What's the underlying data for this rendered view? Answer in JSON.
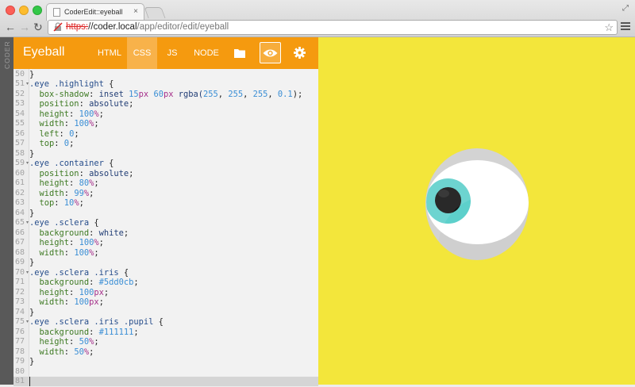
{
  "browser": {
    "tab_title": "CoderEdit::eyeball",
    "url_scheme": "https:",
    "url_host": "//coder.local",
    "url_path": "/app/editor/edit/eyeball",
    "close_glyph": "×"
  },
  "editor": {
    "strip_label": "CODER",
    "app_title": "Eyeball",
    "tabs": [
      {
        "label": "HTML",
        "active": false
      },
      {
        "label": "CSS",
        "active": true
      },
      {
        "label": "JS",
        "active": false
      },
      {
        "label": "NODE",
        "active": false
      }
    ],
    "toolbar_icons": [
      "folder-icon",
      "eye-icon",
      "gear-icon"
    ],
    "toolbar_color": "#f59a0f",
    "line_numbers": [
      "50",
      "51",
      "52",
      "53",
      "54",
      "55",
      "56",
      "57",
      "58",
      "59",
      "60",
      "61",
      "62",
      "63",
      "64",
      "65",
      "66",
      "67",
      "68",
      "69",
      "70",
      "71",
      "72",
      "73",
      "74",
      "75",
      "76",
      "77",
      "78",
      "79",
      "80",
      "81"
    ],
    "fold_lines": [
      "51",
      "59",
      "65",
      "70",
      "75"
    ],
    "code_lines": [
      [
        [
          "}",
          "punc"
        ]
      ],
      [
        [
          ".eye .highlight",
          "sel"
        ],
        [
          " {",
          "punc"
        ]
      ],
      [
        [
          "  box-shadow",
          "prop"
        ],
        [
          ": ",
          "punc"
        ],
        [
          "inset ",
          "val"
        ],
        [
          "15",
          "num"
        ],
        [
          "px",
          "unit"
        ],
        [
          " ",
          "punc"
        ],
        [
          "60",
          "num"
        ],
        [
          "px",
          "unit"
        ],
        [
          " rgba(",
          "val"
        ],
        [
          "255",
          "num"
        ],
        [
          ", ",
          "punc"
        ],
        [
          "255",
          "num"
        ],
        [
          ", ",
          "punc"
        ],
        [
          "255",
          "num"
        ],
        [
          ", ",
          "punc"
        ],
        [
          "0.1",
          "num"
        ],
        [
          ");",
          "punc"
        ]
      ],
      [
        [
          "  position",
          "prop"
        ],
        [
          ": ",
          "punc"
        ],
        [
          "absolute",
          "val"
        ],
        [
          ";",
          "punc"
        ]
      ],
      [
        [
          "  height",
          "prop"
        ],
        [
          ": ",
          "punc"
        ],
        [
          "100",
          "num"
        ],
        [
          "%",
          "unit"
        ],
        [
          ";",
          "punc"
        ]
      ],
      [
        [
          "  width",
          "prop"
        ],
        [
          ": ",
          "punc"
        ],
        [
          "100",
          "num"
        ],
        [
          "%",
          "unit"
        ],
        [
          ";",
          "punc"
        ]
      ],
      [
        [
          "  left",
          "prop"
        ],
        [
          ": ",
          "punc"
        ],
        [
          "0",
          "num"
        ],
        [
          ";",
          "punc"
        ]
      ],
      [
        [
          "  top",
          "prop"
        ],
        [
          ": ",
          "punc"
        ],
        [
          "0",
          "num"
        ],
        [
          ";",
          "punc"
        ]
      ],
      [
        [
          "}",
          "punc"
        ]
      ],
      [
        [
          ".eye .container",
          "sel"
        ],
        [
          " {",
          "punc"
        ]
      ],
      [
        [
          "  position",
          "prop"
        ],
        [
          ": ",
          "punc"
        ],
        [
          "absolute",
          "val"
        ],
        [
          ";",
          "punc"
        ]
      ],
      [
        [
          "  height",
          "prop"
        ],
        [
          ": ",
          "punc"
        ],
        [
          "80",
          "num"
        ],
        [
          "%",
          "unit"
        ],
        [
          ";",
          "punc"
        ]
      ],
      [
        [
          "  width",
          "prop"
        ],
        [
          ": ",
          "punc"
        ],
        [
          "99",
          "num"
        ],
        [
          "%",
          "unit"
        ],
        [
          ";",
          "punc"
        ]
      ],
      [
        [
          "  top",
          "prop"
        ],
        [
          ": ",
          "punc"
        ],
        [
          "10",
          "num"
        ],
        [
          "%",
          "unit"
        ],
        [
          ";",
          "punc"
        ]
      ],
      [
        [
          "}",
          "punc"
        ]
      ],
      [
        [
          ".eye .sclera",
          "sel"
        ],
        [
          " {",
          "punc"
        ]
      ],
      [
        [
          "  background",
          "prop"
        ],
        [
          ": ",
          "punc"
        ],
        [
          "white",
          "val"
        ],
        [
          ";",
          "punc"
        ]
      ],
      [
        [
          "  height",
          "prop"
        ],
        [
          ": ",
          "punc"
        ],
        [
          "100",
          "num"
        ],
        [
          "%",
          "unit"
        ],
        [
          ";",
          "punc"
        ]
      ],
      [
        [
          "  width",
          "prop"
        ],
        [
          ": ",
          "punc"
        ],
        [
          "100",
          "num"
        ],
        [
          "%",
          "unit"
        ],
        [
          ";",
          "punc"
        ]
      ],
      [
        [
          "}",
          "punc"
        ]
      ],
      [
        [
          ".eye .sclera .iris",
          "sel"
        ],
        [
          " {",
          "punc"
        ]
      ],
      [
        [
          "  background",
          "prop"
        ],
        [
          ": ",
          "punc"
        ],
        [
          "#5dd0cb",
          "num"
        ],
        [
          ";",
          "punc"
        ]
      ],
      [
        [
          "  height",
          "prop"
        ],
        [
          ": ",
          "punc"
        ],
        [
          "100",
          "num"
        ],
        [
          "px",
          "unit"
        ],
        [
          ";",
          "punc"
        ]
      ],
      [
        [
          "  width",
          "prop"
        ],
        [
          ": ",
          "punc"
        ],
        [
          "100",
          "num"
        ],
        [
          "px",
          "unit"
        ],
        [
          ";",
          "punc"
        ]
      ],
      [
        [
          "}",
          "punc"
        ]
      ],
      [
        [
          ".eye .sclera .iris .pupil",
          "sel"
        ],
        [
          " {",
          "punc"
        ]
      ],
      [
        [
          "  background",
          "prop"
        ],
        [
          ": ",
          "punc"
        ],
        [
          "#111111",
          "num"
        ],
        [
          ";",
          "punc"
        ]
      ],
      [
        [
          "  height",
          "prop"
        ],
        [
          ": ",
          "punc"
        ],
        [
          "50",
          "num"
        ],
        [
          "%",
          "unit"
        ],
        [
          ";",
          "punc"
        ]
      ],
      [
        [
          "  width",
          "prop"
        ],
        [
          ": ",
          "punc"
        ],
        [
          "50",
          "num"
        ],
        [
          "%",
          "unit"
        ],
        [
          ";",
          "punc"
        ]
      ],
      [
        [
          "}",
          "punc"
        ]
      ],
      [],
      []
    ]
  },
  "preview": {
    "background": "#f3e63b",
    "iris_color": "#5dd0cb",
    "pupil_color": "#111111"
  }
}
